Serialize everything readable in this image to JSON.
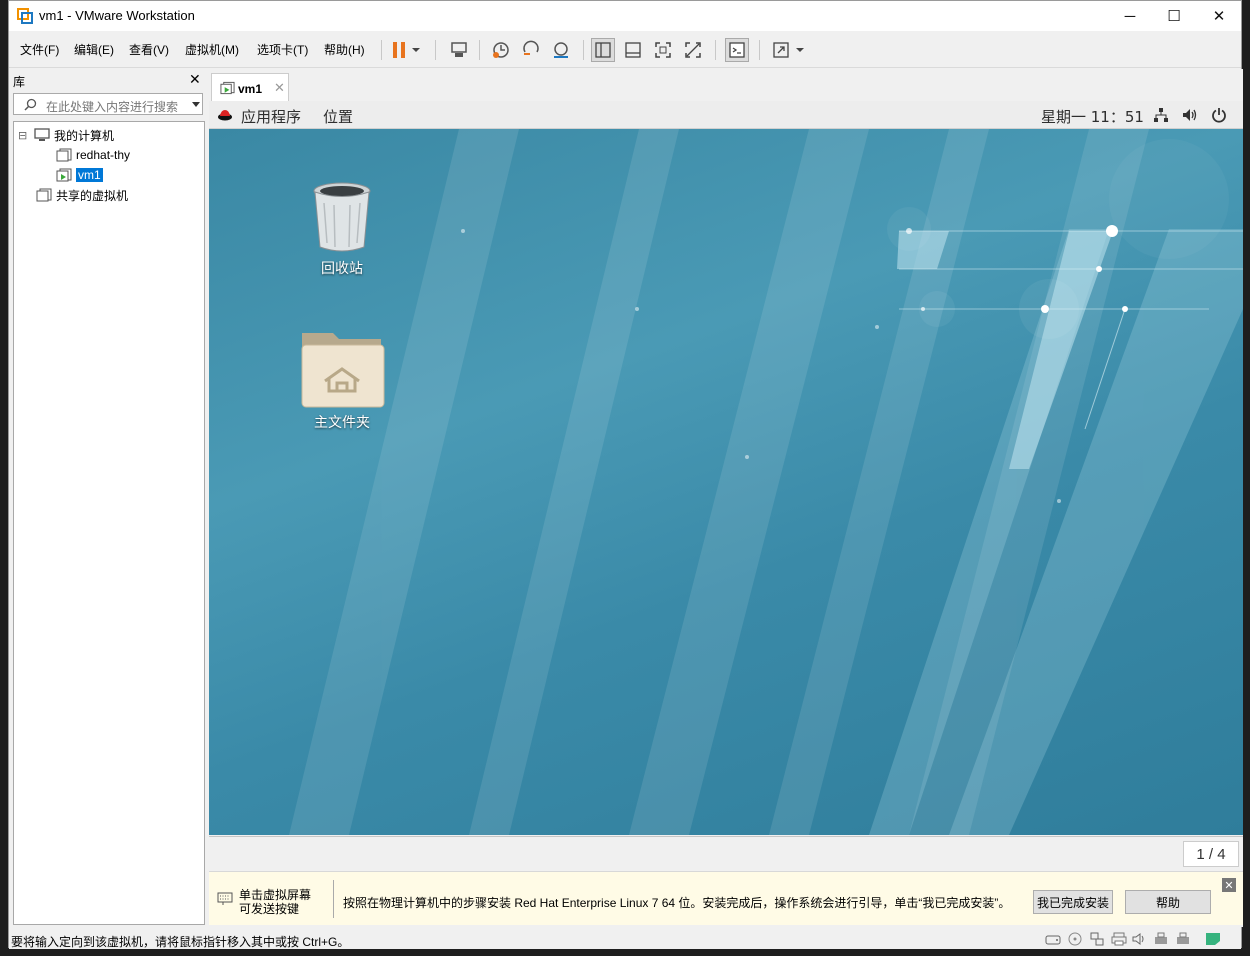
{
  "window": {
    "title": "vm1 - VMware Workstation",
    "minimize_glyph": "─",
    "maximize_glyph": "☐",
    "close_glyph": "✕"
  },
  "menu": {
    "items": [
      "文件(F)",
      "编辑(E)",
      "查看(V)",
      "虚拟机(M)",
      "选项卡(T)",
      "帮助(H)"
    ]
  },
  "toolbar": {
    "icons": [
      "pause-icon",
      "dropdown-arrow-icon",
      "send-ctrl-alt-del-icon",
      "snapshot-icon",
      "revert-snapshot-icon",
      "snapshot-manager-icon",
      "library-toggle-icon",
      "thumbnail-bar-icon",
      "fullscreen-icon",
      "unity-icon",
      "console-icon",
      "stretch-icon",
      "dropdown-arrow-icon"
    ]
  },
  "library": {
    "title": "库",
    "close_glyph": "✕",
    "search_placeholder": "在此处键入内容进行搜索",
    "tree": {
      "collapse_glyph": "⊟",
      "root": "我的计算机",
      "children": [
        "redhat-thy",
        "vm1"
      ],
      "shared": "共享的虚拟机"
    }
  },
  "tab": {
    "label": "vm1",
    "close_glyph": "✕"
  },
  "guest": {
    "applications": "应用程序",
    "places": "位置",
    "clock": "星期一 11：51",
    "desktop_icons": [
      {
        "label": "回收站",
        "icon": "trash-icon"
      },
      {
        "label": "主文件夹",
        "icon": "home-folder-icon"
      }
    ],
    "workspace_indicator": "1 / 4"
  },
  "hint": {
    "left_text_line1": "单击虚拟屏幕",
    "left_text_line2": "可发送按键",
    "message": "按照在物理计算机中的步骤安装 Red Hat Enterprise Linux 7 64 位。安装完成后，操作系统会进行引导，单击“我已完成安装”。",
    "done_button": "我已完成安装",
    "help_button": "帮助",
    "close_glyph": "✕"
  },
  "status": {
    "text": "要将输入定向到该虚拟机，请将鼠标指针移入其中或按 Ctrl+G。"
  },
  "colors": {
    "accent": "#0078d7",
    "pause_orange": "#e8741e",
    "desktop_teal": "#3f8fab",
    "hint_bg": "#fffbe6"
  }
}
